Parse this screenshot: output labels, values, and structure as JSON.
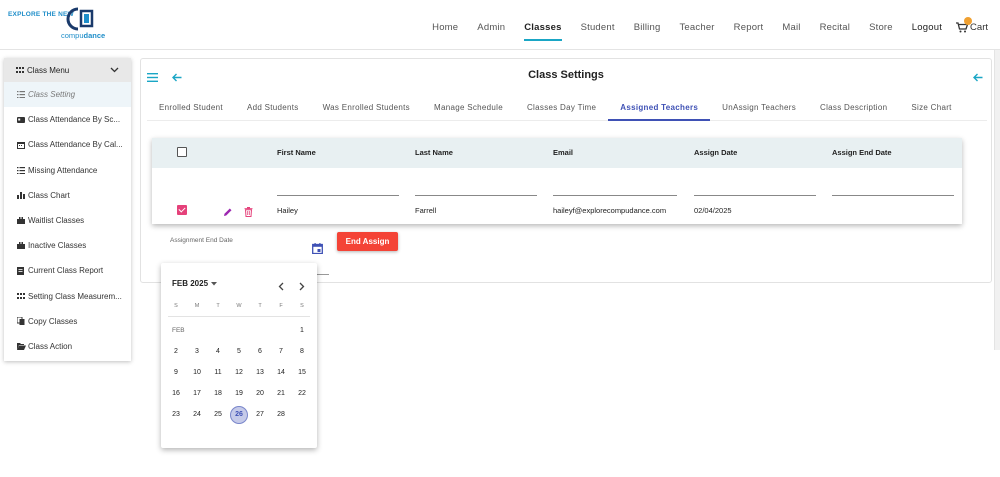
{
  "brand": {
    "tagline": "EXPLORE THE NEW",
    "name_left": "compu",
    "name_right": "dance"
  },
  "nav": {
    "items": [
      "Home",
      "Admin",
      "Classes",
      "Student",
      "Billing",
      "Teacher",
      "Report",
      "Mail",
      "Recital",
      "Store"
    ],
    "active": "Classes",
    "logout": "Logout",
    "cart": "Cart"
  },
  "sidebar": {
    "header": "Class Menu",
    "items": [
      {
        "label": "Class Setting",
        "icon": "list-icon"
      },
      {
        "label": "Class Attendance By Sc...",
        "icon": "id-card-icon"
      },
      {
        "label": "Class Attendance By Cal...",
        "icon": "calendar-icon"
      },
      {
        "label": "Missing Attendance",
        "icon": "list-icon"
      },
      {
        "label": "Class Chart",
        "icon": "bar-chart-icon"
      },
      {
        "label": "Waitlist Classes",
        "icon": "briefcase-icon"
      },
      {
        "label": "Inactive Classes",
        "icon": "briefcase-icon"
      },
      {
        "label": "Current Class Report",
        "icon": "report-icon"
      },
      {
        "label": "Setting Class Measurem...",
        "icon": "grid-icon"
      },
      {
        "label": "Copy Classes",
        "icon": "copy-icon"
      },
      {
        "label": "Class Action",
        "icon": "folder-open-icon"
      }
    ]
  },
  "page": {
    "title": "Class Settings"
  },
  "tabs": [
    "Enrolled Student",
    "Add Students",
    "Was Enrolled Students",
    "Manage Schedule",
    "Classes Day Time",
    "Assigned Teachers",
    "UnAssign Teachers",
    "Class Description",
    "Size Chart"
  ],
  "active_tab": "Assigned Teachers",
  "table": {
    "headers": [
      "First Name",
      "Last Name",
      "Email",
      "Assign Date",
      "Assign End Date"
    ],
    "rows": [
      {
        "first_name": "Hailey",
        "last_name": "Farrell",
        "email": "haileyf@explorecompudance.com",
        "assign_date": "02/04/2025",
        "assign_end_date": ""
      }
    ]
  },
  "assignment_end_date": {
    "label": "Assignment End Date",
    "value": ""
  },
  "end_assign_button": "End Assign",
  "datepicker": {
    "period": "FEB 2025",
    "weekdays": [
      "S",
      "M",
      "T",
      "W",
      "T",
      "F",
      "S"
    ],
    "month_label": "FEB",
    "days": [
      "1",
      "2",
      "3",
      "4",
      "5",
      "6",
      "7",
      "8",
      "9",
      "10",
      "11",
      "12",
      "13",
      "14",
      "15",
      "16",
      "17",
      "18",
      "19",
      "20",
      "21",
      "22",
      "23",
      "24",
      "25",
      "26",
      "27",
      "28"
    ],
    "first_weekday_index": 6,
    "today": "26"
  },
  "colors": {
    "accent": "#3f51b5",
    "nav_active": "#1aa6c5",
    "danger": "#f44336",
    "checkbox": "#e5417a",
    "edit_icon": "#9c27b0"
  }
}
